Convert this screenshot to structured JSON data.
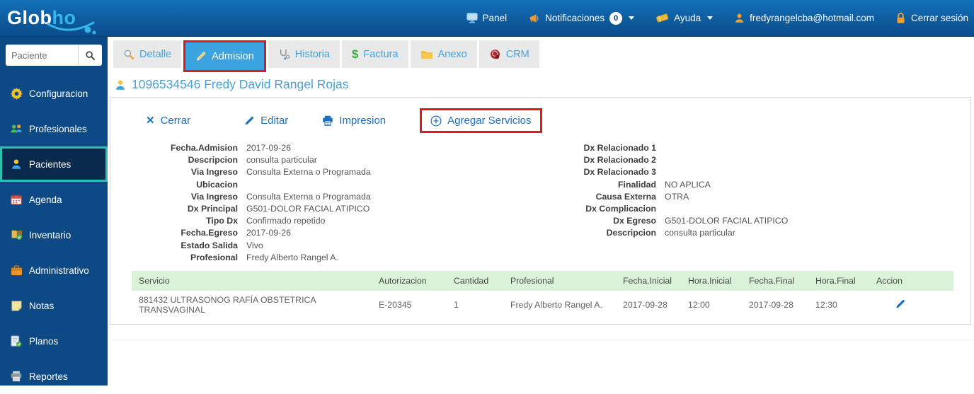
{
  "navbar": {
    "logo_primary": "Glob",
    "logo_accent": "ho",
    "items": {
      "panel": {
        "label": "Panel",
        "icon": "monitor-icon"
      },
      "notifications": {
        "label": "Notificaciones",
        "badge": "0",
        "icon": "horn-icon"
      },
      "help": {
        "label": "Ayuda",
        "icon": "ticket-icon"
      },
      "user": {
        "label": "fredyrangelcba@hotmail.com",
        "icon": "user-icon"
      },
      "logout": {
        "label": "Cerrar sesión",
        "icon": "lock-icon"
      }
    }
  },
  "sidebar": {
    "search_placeholder": "Paciente",
    "items": [
      {
        "label": "Configuracion",
        "icon": "gear-icon"
      },
      {
        "label": "Profesionales",
        "icon": "people-icon"
      },
      {
        "label": "Pacientes",
        "icon": "person-icon",
        "active": true
      },
      {
        "label": "Agenda",
        "icon": "calendar-icon"
      },
      {
        "label": "Inventario",
        "icon": "book-check-icon"
      },
      {
        "label": "Administrativo",
        "icon": "briefcase-icon"
      },
      {
        "label": "Notas",
        "icon": "note-icon"
      },
      {
        "label": "Planos",
        "icon": "document-check-icon"
      },
      {
        "label": "Reportes",
        "icon": "printer-icon"
      }
    ]
  },
  "tabs": [
    {
      "label": "Detalle",
      "icon": "magnifier-icon"
    },
    {
      "label": "Admision",
      "icon": "pencil-icon",
      "active": true,
      "annotated": true
    },
    {
      "label": "Historia",
      "icon": "stethoscope-icon"
    },
    {
      "label": "Factura",
      "icon": "dollar-icon"
    },
    {
      "label": "Anexo",
      "icon": "folder-icon"
    },
    {
      "label": "CRM",
      "icon": "crm-icon"
    }
  ],
  "patient": {
    "title": "1096534546 Fredy David Rangel Rojas"
  },
  "actions": {
    "close": "Cerrar",
    "edit": "Editar",
    "print": "Impresion",
    "add_services": "Agregar Servicios"
  },
  "details": {
    "left": [
      {
        "label": "Fecha.Admision",
        "value": "2017-09-26"
      },
      {
        "label": "Descripcion",
        "value": "consulta particular"
      },
      {
        "label": "Via Ingreso",
        "value": "Consulta Externa o Programada"
      },
      {
        "label": "Ubicacion",
        "value": ""
      },
      {
        "label": "Via Ingreso",
        "value": "Consulta Externa o Programada"
      },
      {
        "label": "Dx Principal",
        "value": "G501-DOLOR FACIAL ATIPICO"
      },
      {
        "label": "Tipo Dx",
        "value": "Confirmado repetido"
      },
      {
        "label": "Fecha.Egreso",
        "value": "2017-09-26"
      },
      {
        "label": "Estado Salida",
        "value": "Vivo"
      },
      {
        "label": "Profesional",
        "value": "Fredy Alberto Rangel A."
      }
    ],
    "right": [
      {
        "label": "Dx Relacionado 1",
        "value": ""
      },
      {
        "label": "Dx Relacionado 2",
        "value": ""
      },
      {
        "label": "Dx Relacionado 3",
        "value": ""
      },
      {
        "label": "Finalidad",
        "value": "NO APLICA"
      },
      {
        "label": "Causa Externa",
        "value": "OTRA"
      },
      {
        "label": "Dx Complicacion",
        "value": ""
      },
      {
        "label": "Dx Egreso",
        "value": "G501-DOLOR FACIAL ATIPICO"
      },
      {
        "label": "Descripcion",
        "value": "consulta particular"
      }
    ]
  },
  "services_table": {
    "headers": [
      "Servicio",
      "Autorizacion",
      "Cantidad",
      "Profesional",
      "Fecha.Inicial",
      "Hora.Inicial",
      "Fecha.Final",
      "Hora.Final",
      "Accion"
    ],
    "rows": [
      [
        "881432 ULTRASONOG RAFÍA OBSTETRICA TRANSVAGINAL",
        "E-20345",
        "1",
        "Fredy Alberto Rangel A.",
        "2017-09-28",
        "12:00",
        "2017-09-28",
        "12:30"
      ]
    ]
  },
  "colors": {
    "brand_accent": "#35b6ea",
    "navbar_blue": "#0f5fa3",
    "sidebar_blue": "#0d4a85",
    "active_tab_blue": "#3aa3e0",
    "link_blue": "#1c70c0",
    "annotation_red": "#dd1b1b",
    "highlight_teal": "#2cc0ae",
    "table_header_green": "#d9f2d8"
  }
}
